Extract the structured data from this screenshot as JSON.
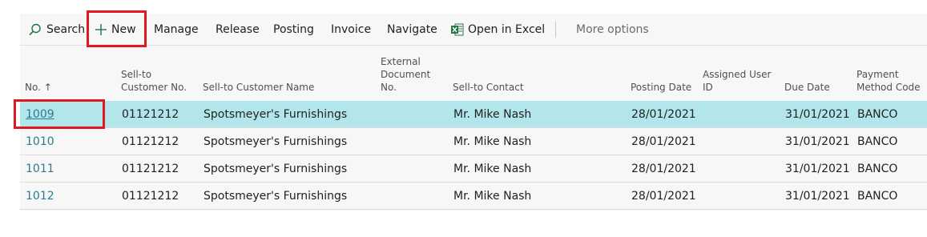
{
  "toolbar": {
    "search_label": "Search",
    "new_label": "New",
    "manage_label": "Manage",
    "release_label": "Release",
    "posting_label": "Posting",
    "invoice_label": "Invoice",
    "navigate_label": "Navigate",
    "excel_label": "Open in Excel",
    "more_label": "More options"
  },
  "columns": {
    "no": "No. ↑",
    "sell_to_no_1": "Sell-to",
    "sell_to_no_2": "Customer No.",
    "sell_to_name": "Sell-to Customer Name",
    "ext_doc_1": "External",
    "ext_doc_2": "Document",
    "ext_doc_3": "No.",
    "contact": "Sell-to Contact",
    "posting_date": "Posting Date",
    "assigned_1": "Assigned User",
    "assigned_2": "ID",
    "due_date": "Due Date",
    "payment_1": "Payment",
    "payment_2": "Method Code"
  },
  "rows": [
    {
      "no": "1009",
      "customer_no": "01121212",
      "customer_name": "Spotsmeyer's Furnishings",
      "ext_doc": "",
      "contact": "Mr. Mike Nash",
      "posting_date": "28/01/2021",
      "assigned_user": "",
      "due_date": "31/01/2021",
      "payment_method": "BANCO"
    },
    {
      "no": "1010",
      "customer_no": "01121212",
      "customer_name": "Spotsmeyer's Furnishings",
      "ext_doc": "",
      "contact": "Mr. Mike Nash",
      "posting_date": "28/01/2021",
      "assigned_user": "",
      "due_date": "31/01/2021",
      "payment_method": "BANCO"
    },
    {
      "no": "1011",
      "customer_no": "01121212",
      "customer_name": "Spotsmeyer's Furnishings",
      "ext_doc": "",
      "contact": "Mr. Mike Nash",
      "posting_date": "28/01/2021",
      "assigned_user": "",
      "due_date": "31/01/2021",
      "payment_method": "BANCO"
    },
    {
      "no": "1012",
      "customer_no": "01121212",
      "customer_name": "Spotsmeyer's Furnishings",
      "ext_doc": "",
      "contact": "Mr. Mike Nash",
      "posting_date": "28/01/2021",
      "assigned_user": "",
      "due_date": "31/01/2021",
      "payment_method": "BANCO"
    }
  ],
  "icons": {
    "search": "search-icon",
    "new": "plus-icon",
    "excel": "excel-icon"
  },
  "colors": {
    "selected_row": "#b2e6eb",
    "link": "#2b7a93",
    "highlight": "#e0181f",
    "excel_green": "#217346"
  }
}
